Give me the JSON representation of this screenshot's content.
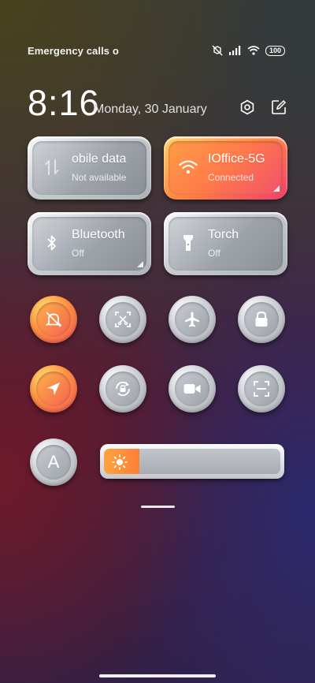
{
  "status_bar": {
    "carrier_text": "Emergency calls o",
    "battery": "100"
  },
  "header": {
    "time": "8:16",
    "date": "Monday, 30 January"
  },
  "tiles": [
    {
      "title": "obile data",
      "subtitle": "Not available",
      "icon": "mobile-data-icon",
      "active": false
    },
    {
      "title": "IOffice-5G",
      "subtitle": "Connected",
      "icon": "wifi-icon",
      "active": true
    },
    {
      "title": "Bluetooth",
      "subtitle": "Off",
      "icon": "bluetooth-icon",
      "active": false
    },
    {
      "title": "Torch",
      "subtitle": "Off",
      "icon": "torch-icon",
      "active": false
    }
  ],
  "toggles": [
    {
      "name": "silent-mode-icon",
      "active": true
    },
    {
      "name": "screenshot-icon",
      "active": false
    },
    {
      "name": "airplane-icon",
      "active": false
    },
    {
      "name": "lock-icon",
      "active": false
    },
    {
      "name": "location-icon",
      "active": true
    },
    {
      "name": "rotation-lock-icon",
      "active": false
    },
    {
      "name": "video-camera-icon",
      "active": false
    },
    {
      "name": "scanner-icon",
      "active": false
    }
  ],
  "auto_brightness": {
    "label": "A"
  },
  "brightness": {
    "level_percent": 20,
    "icon": "sun-icon"
  },
  "colors": {
    "accent_start": "#ffd36b",
    "accent_mid": "#ff8a3d",
    "accent_end": "#f23d6d"
  }
}
